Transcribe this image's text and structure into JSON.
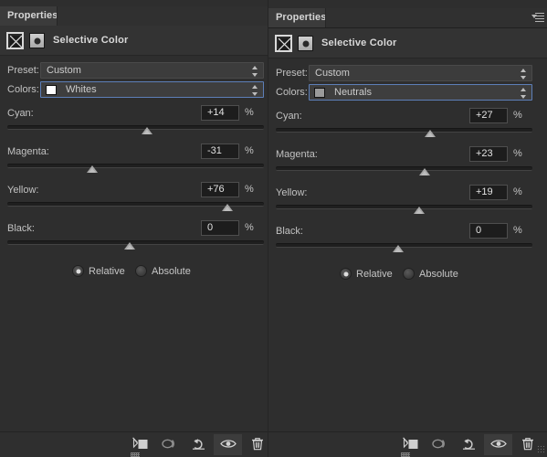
{
  "window": {
    "collapse_icon": "collapse-arrows-icon",
    "close_icon": "close-icon"
  },
  "panels": [
    {
      "id": "left",
      "tab_label": "Properties",
      "adjustment_title": "Selective Color",
      "adjustment_icon": "selective-color-icon",
      "mask_icon": "layer-mask-thumbnail",
      "preset": {
        "label": "Preset:",
        "value": "Custom"
      },
      "colors": {
        "label": "Colors:",
        "value": "Whites",
        "swatch_color": "#ffffff"
      },
      "sliders": [
        {
          "label": "Cyan:",
          "value": "+14",
          "unit": "%",
          "percent": 57.0
        },
        {
          "label": "Magenta:",
          "value": "-31",
          "unit": "%",
          "percent": 34.5
        },
        {
          "label": "Yellow:",
          "value": "+76",
          "unit": "%",
          "percent": 86.0
        },
        {
          "label": "Black:",
          "value": "0",
          "unit": "%",
          "percent": 49.0
        }
      ],
      "method": {
        "selected": "Relative",
        "options": [
          "Relative",
          "Absolute"
        ]
      },
      "toolbar": [
        {
          "icon": "clip-to-layer-icon",
          "name": "clip-to-layer-button",
          "active": false
        },
        {
          "icon": "view-previous-state-icon",
          "name": "view-previous-state-button",
          "active": false
        },
        {
          "icon": "reset-icon",
          "name": "reset-button",
          "active": false
        },
        {
          "icon": "eye-icon",
          "name": "toggle-visibility-button",
          "active": true
        },
        {
          "icon": "trash-icon",
          "name": "delete-layer-button",
          "active": false
        }
      ]
    },
    {
      "id": "right",
      "tab_label": "Properties",
      "adjustment_title": "Selective Color",
      "adjustment_icon": "selective-color-icon",
      "mask_icon": "layer-mask-thumbnail",
      "preset": {
        "label": "Preset:",
        "value": "Custom"
      },
      "colors": {
        "label": "Colors:",
        "value": "Neutrals",
        "swatch_color": "#9a9a9a"
      },
      "sliders": [
        {
          "label": "Cyan:",
          "value": "+27",
          "unit": "%",
          "percent": 63.0
        },
        {
          "label": "Magenta:",
          "value": "+23",
          "unit": "%",
          "percent": 61.0
        },
        {
          "label": "Yellow:",
          "value": "+19",
          "unit": "%",
          "percent": 59.0
        },
        {
          "label": "Black:",
          "value": "0",
          "unit": "%",
          "percent": 49.0
        }
      ],
      "method": {
        "selected": "Relative",
        "options": [
          "Relative",
          "Absolute"
        ]
      },
      "toolbar": [
        {
          "icon": "clip-to-layer-icon",
          "name": "clip-to-layer-button",
          "active": false
        },
        {
          "icon": "view-previous-state-icon",
          "name": "view-previous-state-button",
          "active": false
        },
        {
          "icon": "reset-icon",
          "name": "reset-button",
          "active": false
        },
        {
          "icon": "eye-icon",
          "name": "toggle-visibility-button",
          "active": true
        },
        {
          "icon": "trash-icon",
          "name": "delete-layer-button",
          "active": false
        }
      ]
    }
  ]
}
